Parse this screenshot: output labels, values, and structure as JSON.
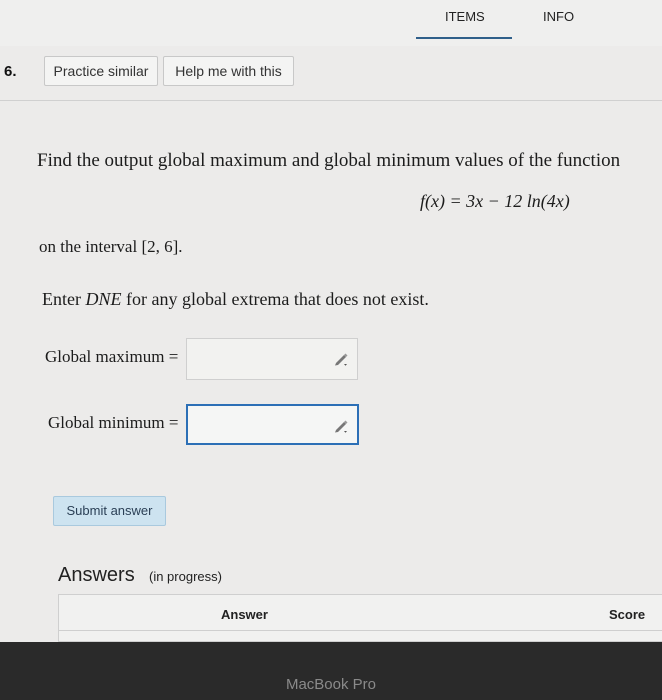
{
  "tabs": {
    "items": "ITEMS",
    "info": "INFO"
  },
  "question": {
    "number": "6.",
    "practice_label": "Practice similar",
    "help_label": "Help me with this",
    "prompt": "Find the output global maximum and global minimum values of the function",
    "formula": "f(x) = 3x − 12 ln(4x)",
    "interval": "on the interval [2, 6].",
    "dne_prefix": "Enter ",
    "dne_word": "DNE",
    "dne_suffix": " for any global extrema that does not exist.",
    "max_label": "Global maximum =",
    "min_label": "Global minimum =",
    "max_value": "",
    "min_value": "",
    "submit_label": "Submit answer"
  },
  "answers": {
    "title": "Answers",
    "subtitle": "(in progress)",
    "columns": [
      "Answer",
      "Score"
    ]
  },
  "device": {
    "label": "MacBook Pro"
  },
  "colors": {
    "accent": "#2c6fb6",
    "submit_bg": "#cde3f0",
    "tab_underline": "#2f5f8a"
  },
  "icons": {
    "answer_field": "pencil-icon"
  }
}
